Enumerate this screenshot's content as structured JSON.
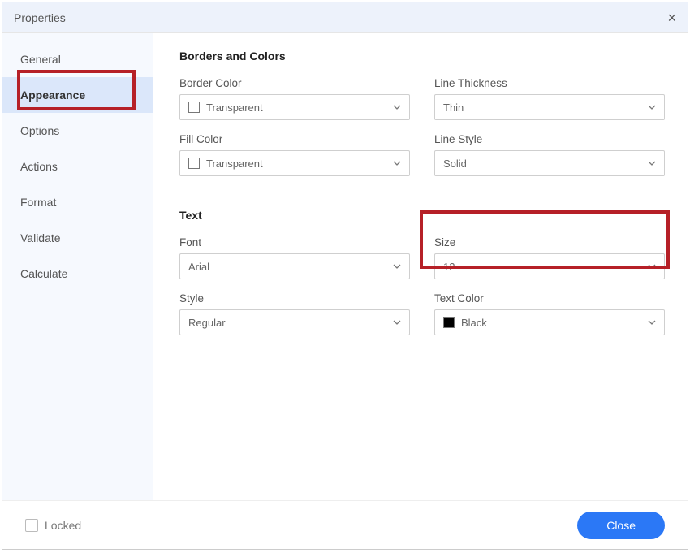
{
  "title": "Properties",
  "sidebar": {
    "items": [
      {
        "label": "General"
      },
      {
        "label": "Appearance"
      },
      {
        "label": "Options"
      },
      {
        "label": "Actions"
      },
      {
        "label": "Format"
      },
      {
        "label": "Validate"
      },
      {
        "label": "Calculate"
      }
    ],
    "selected_index": 1
  },
  "sections": {
    "borders_heading": "Borders and Colors",
    "text_heading": "Text"
  },
  "borders": {
    "border_color": {
      "label": "Border Color",
      "value": "Transparent"
    },
    "line_thickness": {
      "label": "Line Thickness",
      "value": "Thin"
    },
    "fill_color": {
      "label": "Fill Color",
      "value": "Transparent"
    },
    "line_style": {
      "label": "Line Style",
      "value": "Solid"
    }
  },
  "text": {
    "font": {
      "label": "Font",
      "value": "Arial"
    },
    "size": {
      "label": "Size",
      "value": "12"
    },
    "style": {
      "label": "Style",
      "value": "Regular"
    },
    "text_color": {
      "label": "Text Color",
      "value": "Black"
    }
  },
  "footer": {
    "locked_label": "Locked",
    "close_label": "Close"
  }
}
